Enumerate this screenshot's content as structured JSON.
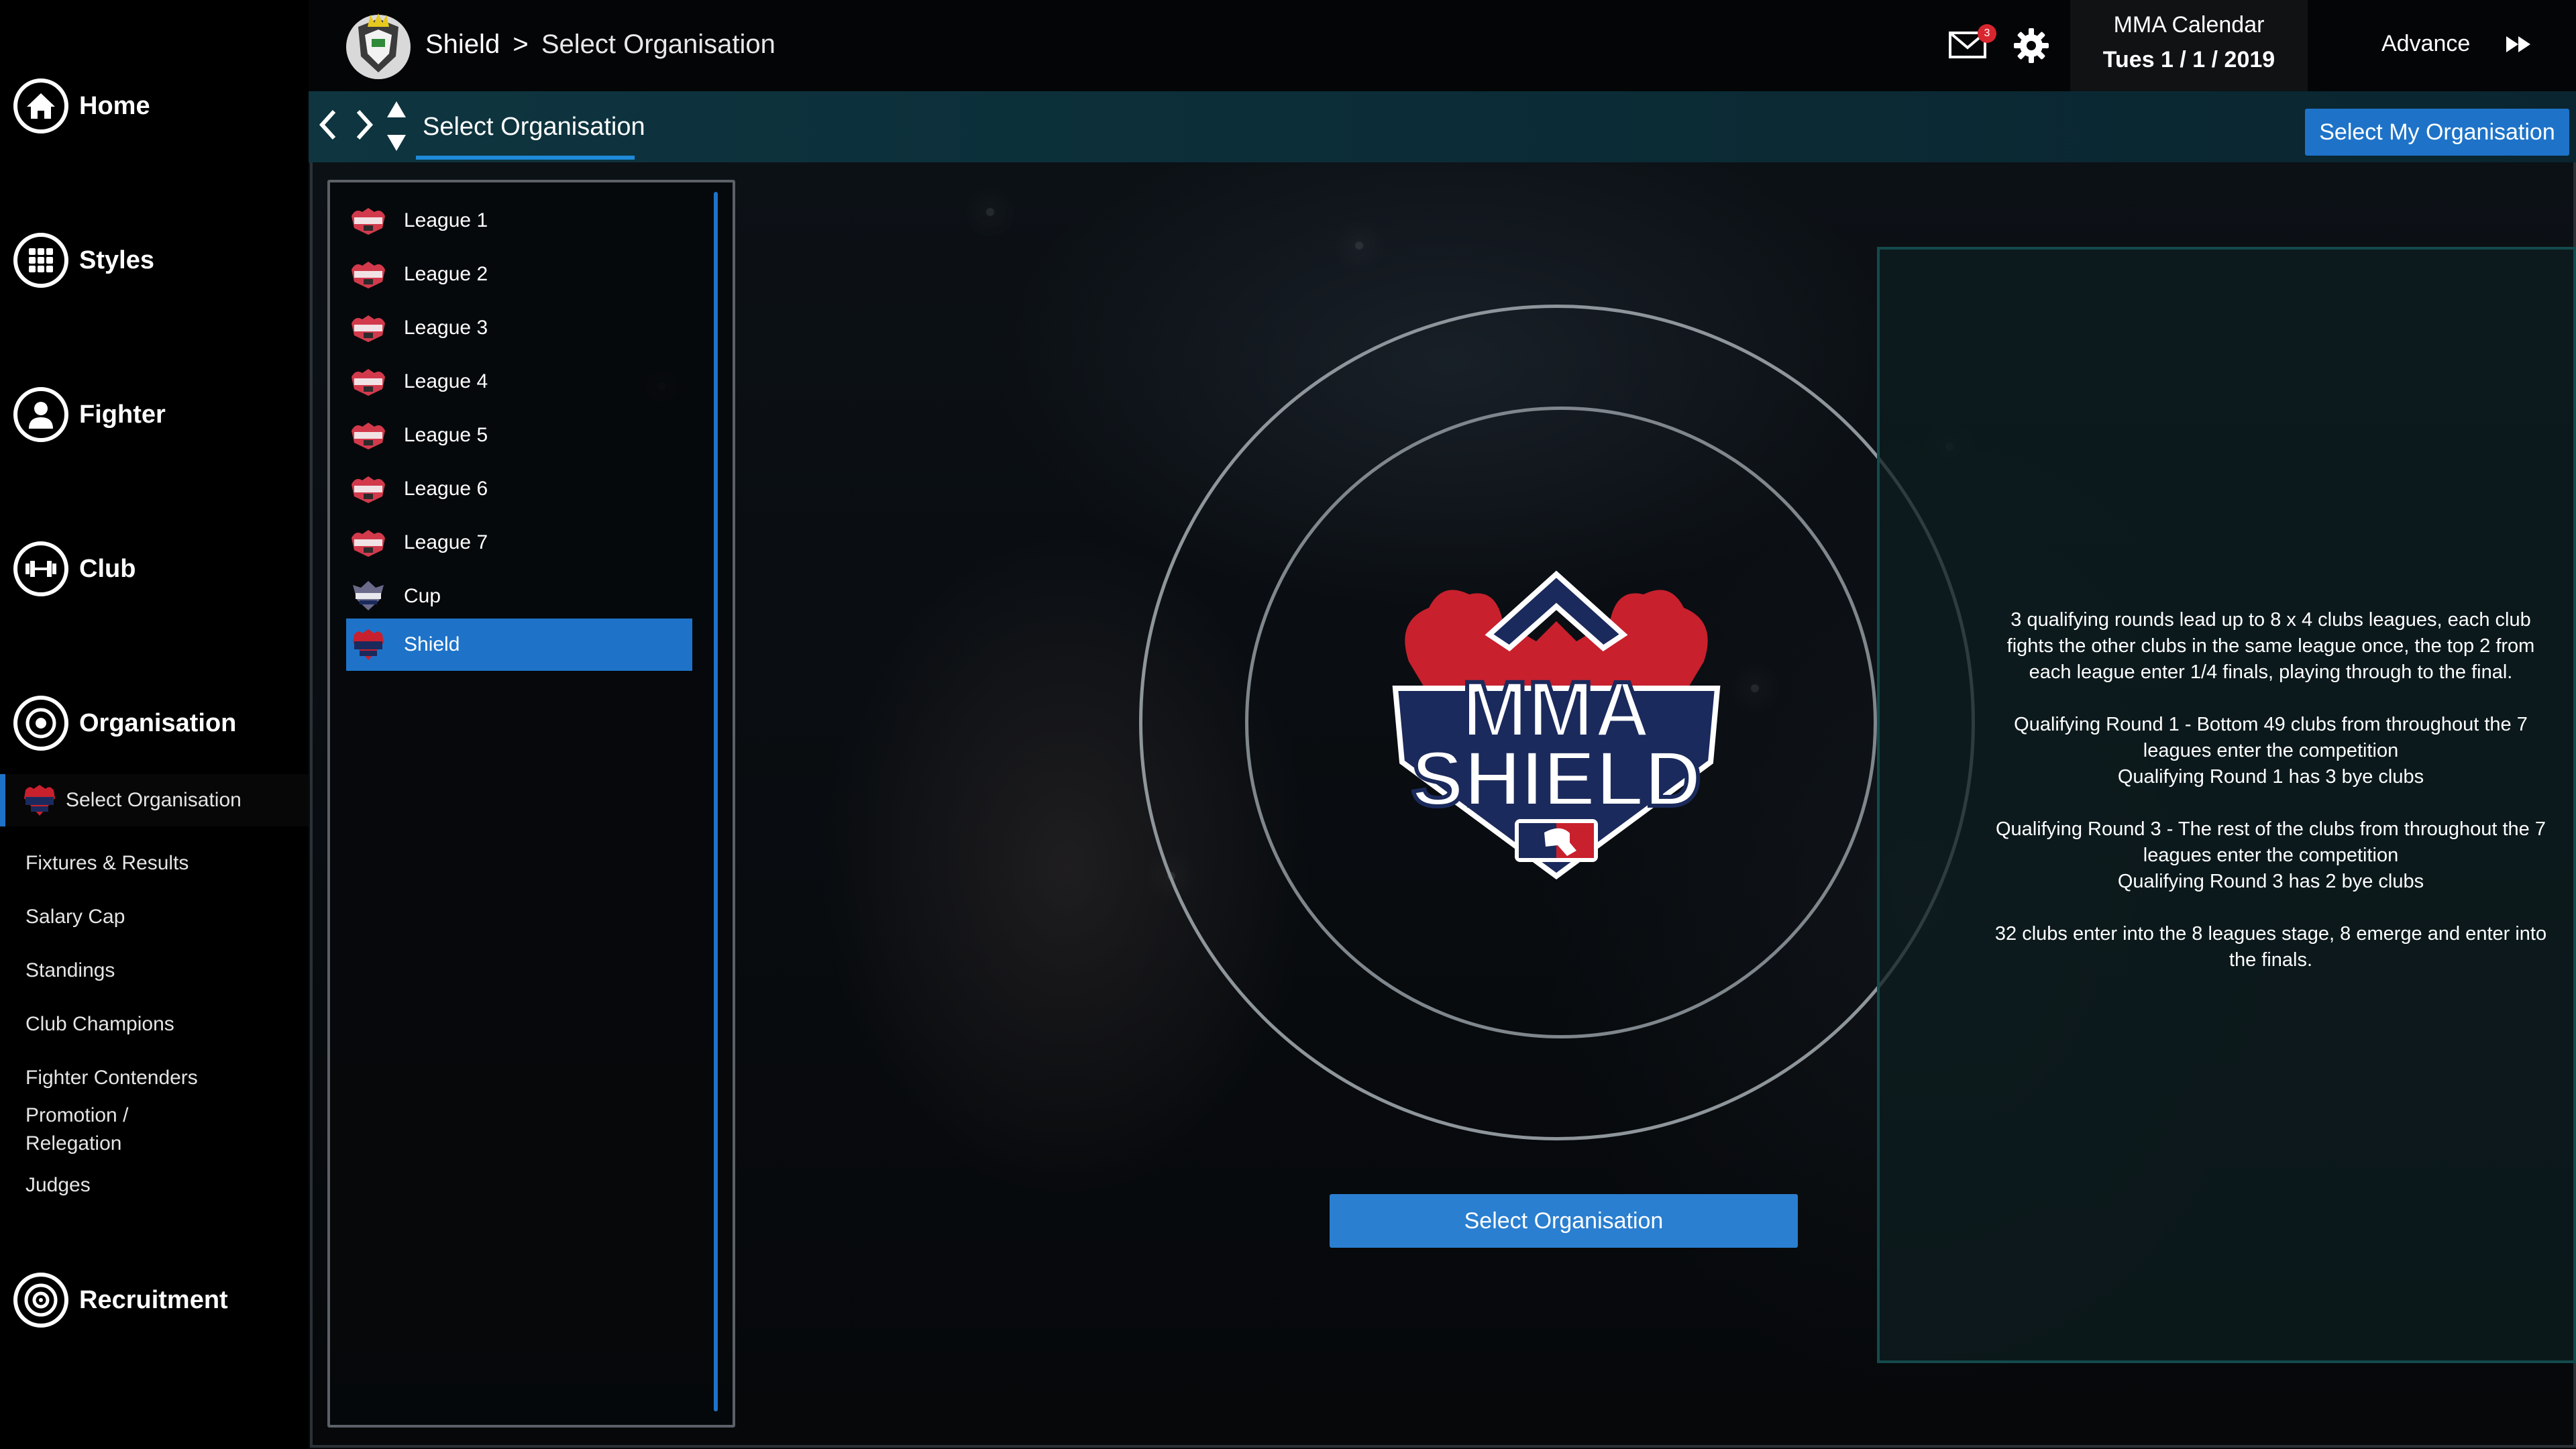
{
  "sidebar": {
    "items": [
      {
        "label": "Home",
        "icon": "home-icon"
      },
      {
        "label": "Styles",
        "icon": "grid-icon"
      },
      {
        "label": "Fighter",
        "icon": "person-icon"
      },
      {
        "label": "Club",
        "icon": "dumbbell-icon"
      },
      {
        "label": "Organisation",
        "icon": "organisation-icon"
      },
      {
        "label": "Recruitment",
        "icon": "target-icon"
      }
    ],
    "organisation_sub": [
      {
        "label": "Select Organisation",
        "active": true
      },
      {
        "label": "Fixtures & Results"
      },
      {
        "label": "Salary Cap"
      },
      {
        "label": "Standings"
      },
      {
        "label": "Club Champions"
      },
      {
        "label": "Fighter Contenders"
      },
      {
        "label": "Promotion /"
      },
      {
        "label": "Relegation"
      },
      {
        "label": "Judges"
      }
    ]
  },
  "header": {
    "breadcrumb_org": "Shield",
    "breadcrumb_sep": ">",
    "breadcrumb_page": "Select Organisation",
    "mail_count": "3",
    "calendar_title": "MMA Calendar",
    "calendar_date": "Tues 1 / 1 / 2019",
    "advance_label": "Advance"
  },
  "subheader": {
    "tab_label": "Select Organisation",
    "select_my_org_label": "Select My Organisation"
  },
  "leagues": [
    {
      "label": "League 1"
    },
    {
      "label": "League 2"
    },
    {
      "label": "League 3"
    },
    {
      "label": "League 4"
    },
    {
      "label": "League 5"
    },
    {
      "label": "League 6"
    },
    {
      "label": "League 7"
    },
    {
      "label": "Cup"
    },
    {
      "label": "Shield",
      "selected": true
    }
  ],
  "main": {
    "logo_line1": "MMA",
    "logo_line2": "SHIELD",
    "select_button_label": "Select Organisation"
  },
  "description": {
    "paragraphs": [
      "3 qualifying rounds lead up to 8 x 4 clubs leagues, each club fights the other clubs in the same league once, the top 2 from each league enter 1/4 finals, playing through to the final.",
      "Qualifying Round 1 - Bottom 49 clubs from throughout the 7 leagues enter the competition",
      "Qualifying Round 1 has 3 bye clubs",
      "Qualifying Round 3 - The rest of the clubs from throughout the 7 leagues enter the competition",
      "Qualifying Round 3 has 2 bye clubs",
      "32 clubs enter into the 8 leagues stage, 8 emerge and enter into the finals."
    ]
  },
  "colors": {
    "accent": "#1e73c8",
    "logo_red": "#c8202d",
    "logo_navy": "#1b2a5c",
    "panel_border": "#144b4d"
  }
}
